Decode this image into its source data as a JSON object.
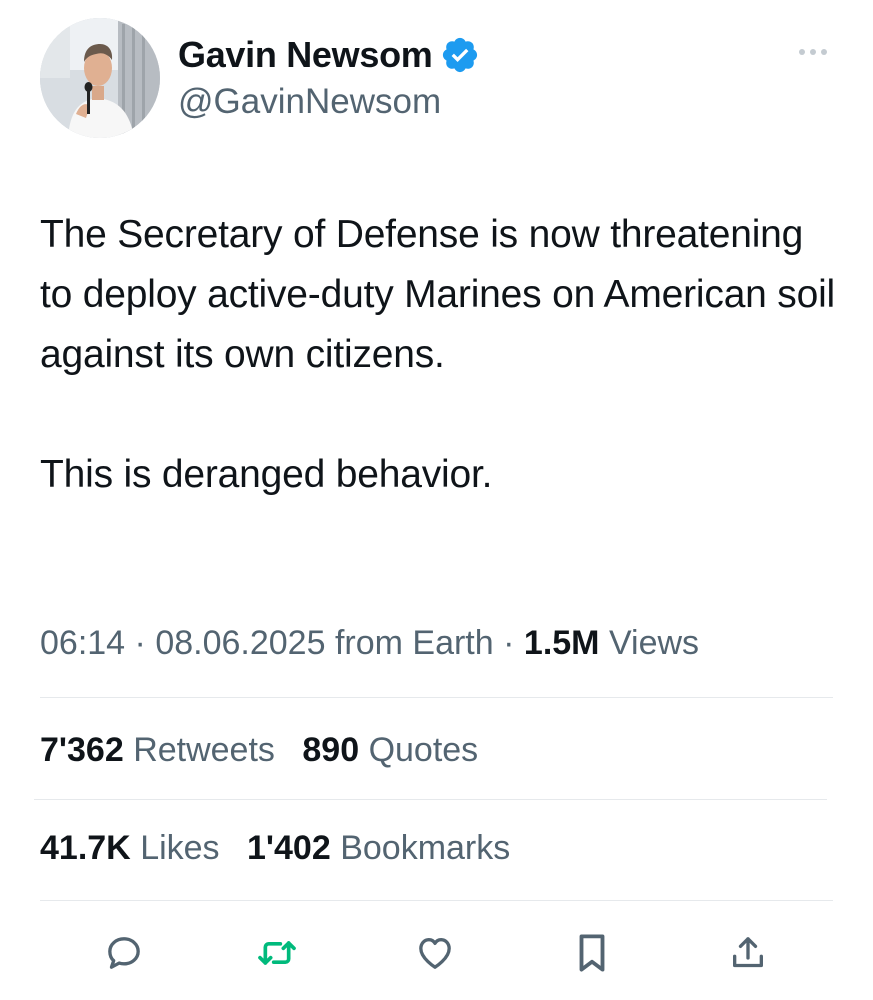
{
  "author": {
    "display_name": "Gavin Newsom",
    "handle": "@GavinNewsom",
    "verified": true,
    "verified_color": "#1d9bf0"
  },
  "tweet": {
    "paragraphs": [
      "The Secretary of Defense is now threatening to deploy active-duty Marines on American soil against its own citizens.",
      "This is deranged behavior."
    ]
  },
  "meta": {
    "time": "06:14",
    "separator": "·",
    "date": "08.06.2025",
    "source": "from Earth",
    "views_count": "1.5M",
    "views_label": "Views"
  },
  "stats": {
    "retweets": {
      "count": "7'362",
      "label": "Retweets"
    },
    "quotes": {
      "count": "890",
      "label": "Quotes"
    },
    "likes": {
      "count": "41.7K",
      "label": "Likes"
    },
    "bookmarks": {
      "count": "1'402",
      "label": "Bookmarks"
    }
  },
  "actions": [
    {
      "name": "reply",
      "icon": "reply-icon"
    },
    {
      "name": "retweet",
      "icon": "retweet-icon",
      "color": "#00ba7c"
    },
    {
      "name": "like",
      "icon": "heart-icon"
    },
    {
      "name": "bookmark",
      "icon": "bookmark-icon"
    },
    {
      "name": "share",
      "icon": "share-icon"
    }
  ],
  "colors": {
    "text_primary": "#0f1419",
    "text_secondary": "#536471",
    "icon": "#536471",
    "retweet": "#00ba7c",
    "divider": "#e6e9ec"
  }
}
